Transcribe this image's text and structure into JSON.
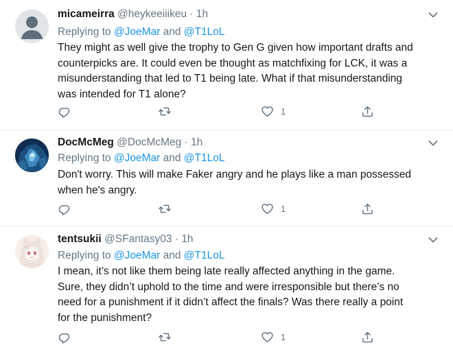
{
  "colors": {
    "link": "#1b95e0",
    "muted": "#657786",
    "text": "#14171a",
    "divider": "#e6ecf0"
  },
  "icons": {
    "reply": "reply-icon",
    "retweet": "retweet-icon",
    "like": "heart-icon",
    "share": "share-icon",
    "menu": "chevron-down-icon"
  },
  "tweets": [
    {
      "display_name": "micameirra",
      "handle": "@heykeeiiikeu",
      "sep": "·",
      "time": "1h",
      "replying_prefix": "Replying to",
      "mention_1": "@JoeMar",
      "and": "and",
      "mention_2": "@T1LoL",
      "lines": [
        "They might as well give the trophy to Gen G given how important drafts and",
        "counterpicks are. It could even be thought as matchfixing for LCK, it was a",
        "misunderstanding that led to T1 being late. What if that misunderstanding",
        "was intended for T1 alone?"
      ],
      "likes": "1"
    },
    {
      "display_name": "DocMcMeg",
      "handle": "@DocMcMeg",
      "sep": "·",
      "time": "1h",
      "replying_prefix": "Replying to",
      "mention_1": "@JoeMar",
      "and": "and",
      "mention_2": "@T1LoL",
      "lines": [
        "Don't worry. This will make Faker angry and he plays like a man possessed",
        "when he's angry."
      ],
      "likes": "1"
    },
    {
      "display_name": "tentsukii",
      "handle": "@SFantasy03",
      "sep": "·",
      "time": "1h",
      "replying_prefix": "Replying to",
      "mention_1": "@JoeMar",
      "and": "and",
      "mention_2": "@T1LoL",
      "lines": [
        "I mean, it’s not like them being late really affected anything in the game.",
        "Sure, they didn’t uphold to the time and were irresponsible but there’s no",
        "need for a punishment if it didn’t affect the finals? Was there really a point",
        "for the punishment?"
      ],
      "likes": "1"
    }
  ]
}
